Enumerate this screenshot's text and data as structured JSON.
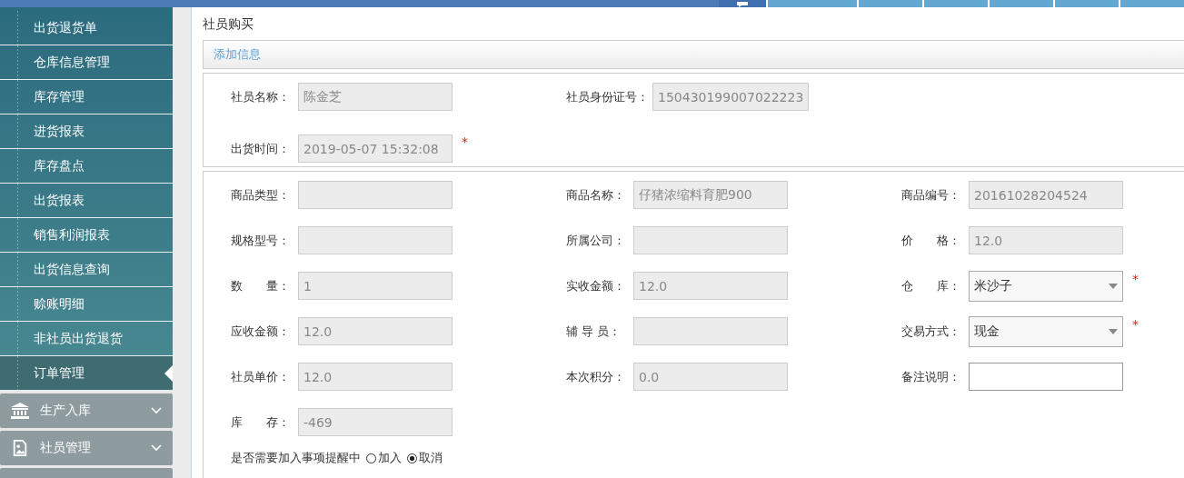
{
  "top_tabs": [
    {
      "selected": true
    },
    {
      "selected": false
    },
    {
      "selected": false
    },
    {
      "selected": false
    },
    {
      "selected": false
    },
    {
      "selected": false
    },
    {
      "selected": false
    }
  ],
  "sidebar": {
    "items": [
      {
        "label": "出货退货单",
        "selected": false
      },
      {
        "label": "仓库信息管理",
        "selected": false
      },
      {
        "label": "库存管理",
        "selected": false
      },
      {
        "label": "进货报表",
        "selected": false
      },
      {
        "label": "库存盘点",
        "selected": false
      },
      {
        "label": "出货报表",
        "selected": false
      },
      {
        "label": "销售利润报表",
        "selected": false
      },
      {
        "label": "出货信息查询",
        "selected": false
      },
      {
        "label": "赊账明细",
        "selected": false
      },
      {
        "label": "非社员出货退货",
        "selected": false
      },
      {
        "label": "订单管理",
        "selected": true
      }
    ],
    "groups": [
      {
        "label": "生产入库",
        "expanded": false
      },
      {
        "label": "社员管理",
        "expanded": false
      }
    ]
  },
  "page_title": "社员购买",
  "panel_title": "添加信息",
  "section_1": [
    {
      "label": "社员名称：",
      "value": "陈金芝",
      "kind": "text",
      "readonly": true
    },
    {
      "label": "社员身份证号：",
      "value": "150430199007022223",
      "kind": "text",
      "readonly": true
    },
    {
      "label": "出货时间：",
      "value": "2019-05-07 15:32:08",
      "kind": "text",
      "readonly": true,
      "required_mark": "*"
    }
  ],
  "section_2": [
    {
      "label": "商品类型：",
      "kind": "text",
      "readonly": true
    },
    {
      "label": "商品名称：",
      "value": "仔猪浓缩料育肥900",
      "kind": "text",
      "readonly": true
    },
    {
      "label": "商品编号：",
      "value": "20161028204524",
      "kind": "text",
      "readonly": true
    },
    {
      "label": "规格型号：",
      "kind": "text",
      "readonly": true
    },
    {
      "label": "所属公司：",
      "kind": "text",
      "readonly": true
    },
    {
      "label": "价　　格：",
      "value": "12.0",
      "kind": "text",
      "readonly": true
    },
    {
      "label": "数　　量：",
      "value": "1",
      "kind": "text",
      "readonly": true
    },
    {
      "label": "实收金额：",
      "value": "12.0",
      "kind": "text",
      "readonly": true
    },
    {
      "label": "仓　　库：",
      "value": "米沙子",
      "kind": "select",
      "readonly": false,
      "required_mark": "*"
    },
    {
      "label": "应收金额：",
      "value": "12.0",
      "kind": "text",
      "readonly": true
    },
    {
      "label": "辅 导 员：",
      "kind": "text",
      "readonly": true
    },
    {
      "label": "交易方式：",
      "value": "现金",
      "kind": "select",
      "readonly": false,
      "required_mark": "*"
    },
    {
      "label": "社员单价：",
      "value": "12.0",
      "kind": "text",
      "readonly": true
    },
    {
      "label": "本次积分：",
      "value": "0.0",
      "kind": "text",
      "readonly": true
    },
    {
      "label": "备注说明：",
      "kind": "text",
      "readonly": false
    },
    {
      "label": "库　　存：",
      "value": "-469",
      "kind": "text",
      "readonly": true
    }
  ],
  "reminder": {
    "question": "是否需要加入事项提醒中",
    "options": [
      {
        "label": "加入",
        "selected": false
      },
      {
        "label": "取消",
        "selected": true
      }
    ]
  }
}
